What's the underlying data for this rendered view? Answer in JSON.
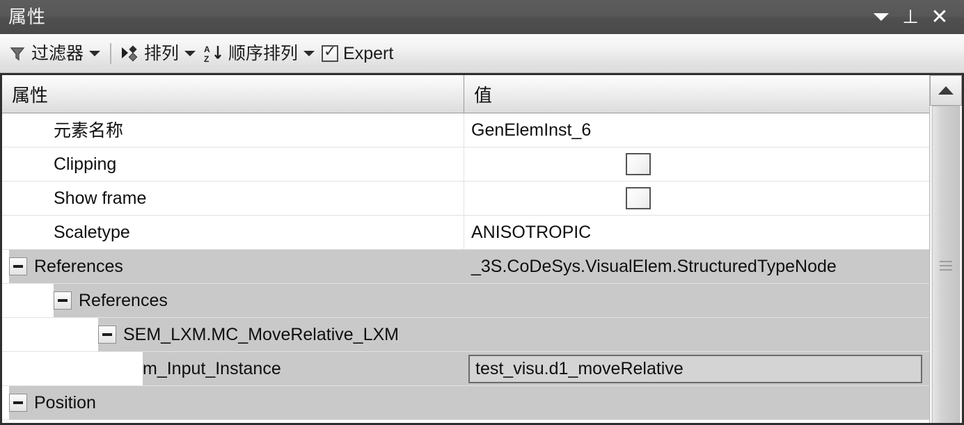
{
  "window": {
    "title": "属性",
    "controls": [
      {
        "name": "minimize-dropdown",
        "icon": "chevron-down-icon"
      },
      {
        "name": "auto-hide-pin",
        "icon": "pin-icon",
        "glyph": "⊥"
      },
      {
        "name": "close",
        "icon": "close-icon",
        "glyph": "✕"
      }
    ]
  },
  "toolbar": {
    "filter_label": "过滤器",
    "filter_icon": "filter-funnel-icon",
    "arrange_label": "排列",
    "arrange_icon": "group-arrange-icon",
    "sort_label": "顺序排列",
    "sort_icon": "sort-az-icon",
    "expert_label": "Expert",
    "expert_checked": true
  },
  "grid": {
    "headers": {
      "property": "属性",
      "value": "值"
    },
    "rows": [
      {
        "label": "元素名称",
        "value": "GenElemInst_6",
        "indent": 1,
        "cjk": true,
        "group": false,
        "expander": false,
        "value_type": "text"
      },
      {
        "label": "Clipping",
        "value": "",
        "indent": 1,
        "cjk": false,
        "group": false,
        "expander": false,
        "value_type": "checkbox",
        "checked": false
      },
      {
        "label": "Show frame",
        "value": "",
        "indent": 1,
        "cjk": false,
        "group": false,
        "expander": false,
        "value_type": "checkbox",
        "checked": false
      },
      {
        "label": "Scaletype",
        "value": "ANISOTROPIC",
        "indent": 1,
        "cjk": false,
        "group": false,
        "expander": false,
        "value_type": "text"
      },
      {
        "label": "References",
        "value": "_3S.CoDeSys.VisualElem.StructuredTypeNode",
        "indent": 0,
        "cjk": false,
        "group": true,
        "expander": true,
        "value_type": "text"
      },
      {
        "label": "References",
        "value": "",
        "indent": 1,
        "cjk": false,
        "group": true,
        "expander": true,
        "value_type": "text"
      },
      {
        "label": "SEM_LXM.MC_MoveRelative_LXM",
        "value": "",
        "indent": 2,
        "cjk": false,
        "group": true,
        "expander": true,
        "value_type": "text"
      },
      {
        "label": "m_Input_Instance",
        "value": "test_visu.d1_moveRelative",
        "indent": 3,
        "cjk": false,
        "group": true,
        "expander": false,
        "value_type": "editbox"
      },
      {
        "label": "Position",
        "value": "",
        "indent": 0,
        "cjk": false,
        "group": true,
        "expander": true,
        "value_type": "text"
      }
    ]
  },
  "scrollbar": {
    "up_icon": "chevron-up-icon"
  }
}
